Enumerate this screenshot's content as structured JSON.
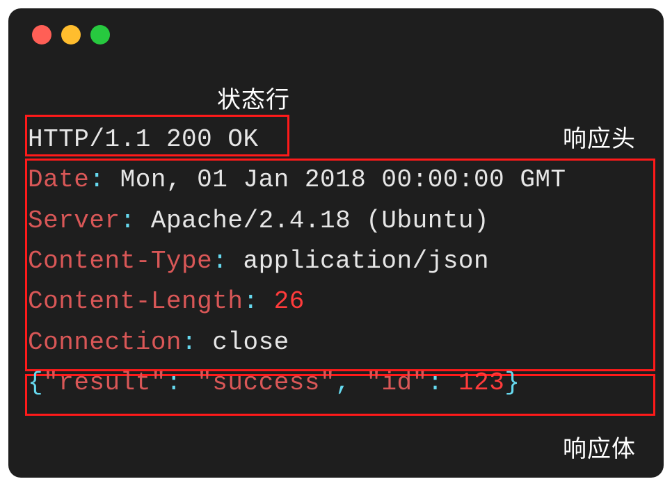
{
  "labels": {
    "status_line": "状态行",
    "response_headers": "响应头",
    "response_body": "响应体"
  },
  "status_line": {
    "protocol": "HTTP/1.1",
    "code": "200",
    "reason": "OK"
  },
  "headers": [
    {
      "name": "Date",
      "value": "Mon, 01 Jan 2018 00:00:00 GMT"
    },
    {
      "name": "Server",
      "value": "Apache/2.4.18 (Ubuntu)"
    },
    {
      "name": "Content-Type",
      "value": "application/json"
    },
    {
      "name": "Content-Length",
      "value": "26"
    },
    {
      "name": "Connection",
      "value": "close"
    }
  ],
  "body_json": {
    "result": "success",
    "id": 123
  },
  "colors": {
    "window_bg": "#1e1e1e",
    "highlight_box": "#ff1a1a",
    "key": "#d95757",
    "punct": "#66d9ef",
    "text": "#e6e6e6",
    "number": "#ff3b3b"
  }
}
